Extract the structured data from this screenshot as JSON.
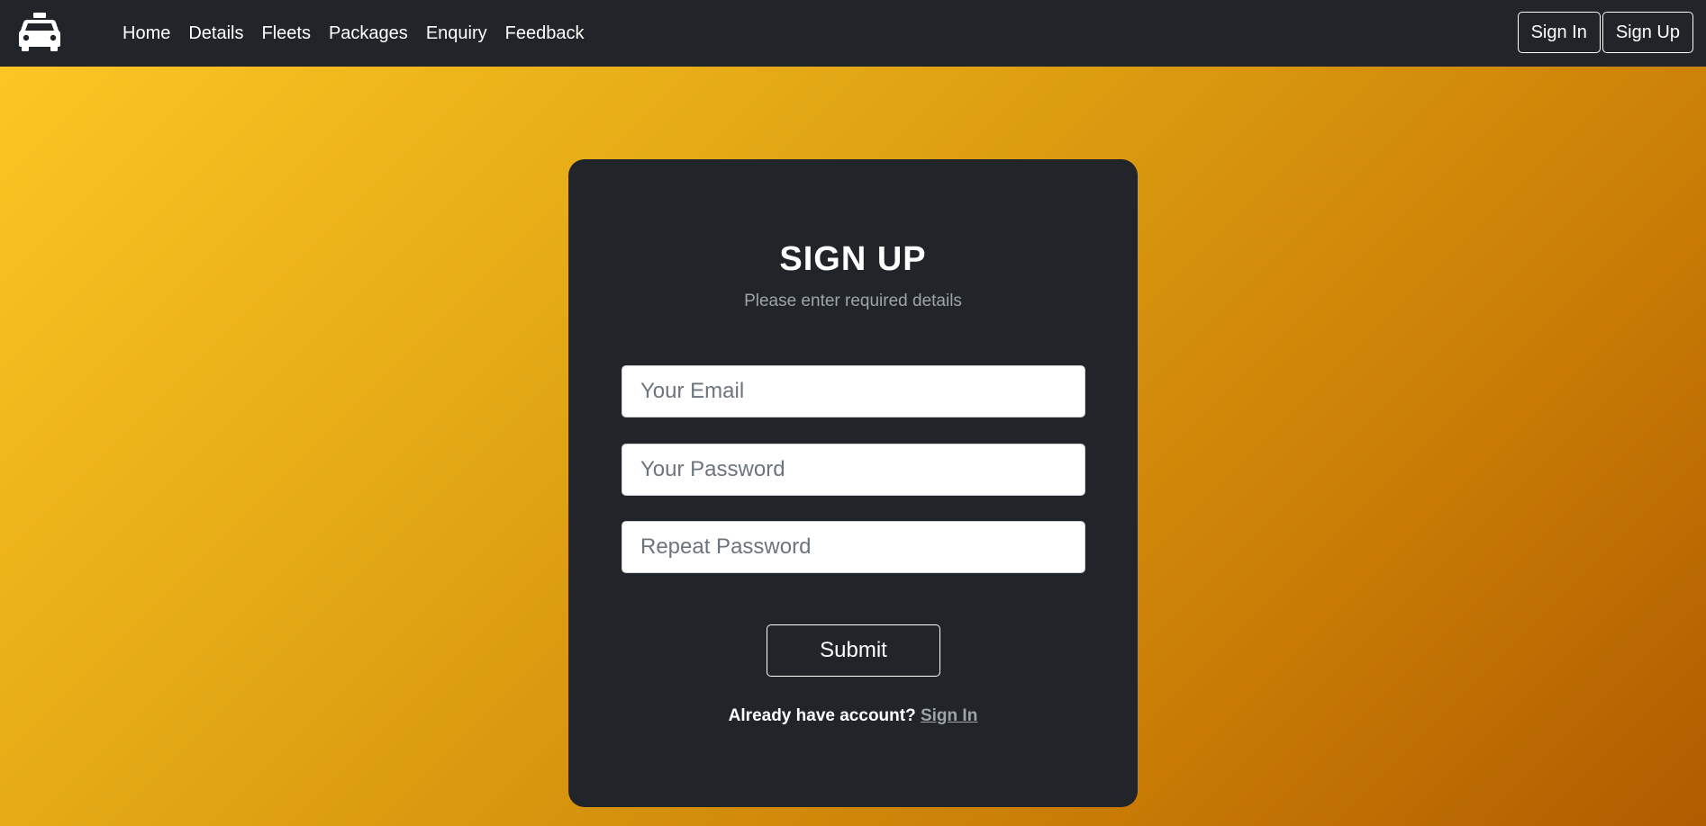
{
  "nav": {
    "logo_icon": "taxi-icon",
    "links": [
      "Home",
      "Details",
      "Fleets",
      "Packages",
      "Enquiry",
      "Feedback"
    ],
    "signin_label": "Sign In",
    "signup_label": "Sign Up"
  },
  "form": {
    "title": "SIGN UP",
    "subtitle": "Please enter required details",
    "email_placeholder": "Your Email",
    "password_placeholder": "Your Password",
    "repeat_placeholder": "Repeat Password",
    "submit_label": "Submit",
    "account_prompt": "Already have account?",
    "signin_link": "Sign In"
  },
  "colors": {
    "navbar": "#212529",
    "card": "#212529",
    "gradient_start": "#fec824",
    "gradient_end": "#b05c00"
  }
}
